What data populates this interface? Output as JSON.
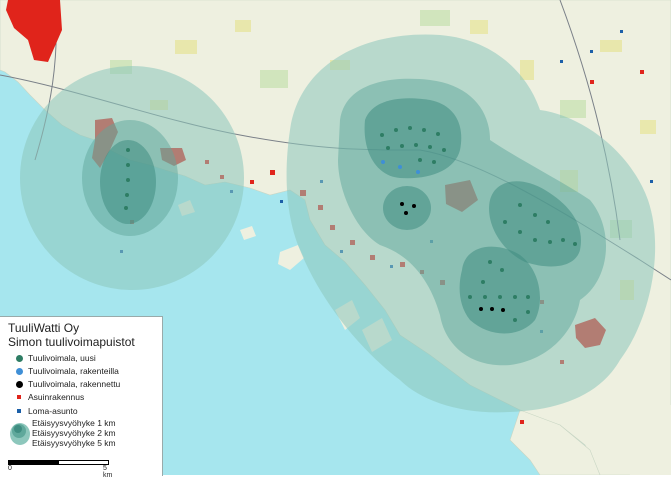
{
  "colors": {
    "sea": "#a6e6ee",
    "land": "#eef0e0",
    "zone_5km": "#8dc7bc",
    "zone_2km": "#5fa89b",
    "zone_1km": "#3f8d81",
    "turbine_new": "#2e7d64",
    "turbine_construction": "#3f8fd6",
    "turbine_built": "#000000",
    "residential": "#e0241b",
    "holiday": "#1b5fa8"
  },
  "legend": {
    "company": "TuuliWatti Oy",
    "project": "Simon tuulivoimapuistot",
    "items": [
      {
        "icon": "turbine-new-icon",
        "label": "Tuulivoimala, uusi"
      },
      {
        "icon": "turbine-construction-icon",
        "label": "Tuulivoimala, rakenteilla"
      },
      {
        "icon": "turbine-built-icon",
        "label": "Tuulivoimala, rakennettu"
      },
      {
        "icon": "residential-icon",
        "label": "Asuinrakennus"
      },
      {
        "icon": "holiday-home-icon",
        "label": "Loma-asunto"
      }
    ],
    "zones": [
      {
        "label": "Etäisyysvyöhyke 1 km"
      },
      {
        "label": "Etäisyysvyöhyke 2 km"
      },
      {
        "label": "Etäisyysvyöhyke 5 km"
      }
    ],
    "scale": {
      "start": "0",
      "end": "5 km"
    }
  }
}
